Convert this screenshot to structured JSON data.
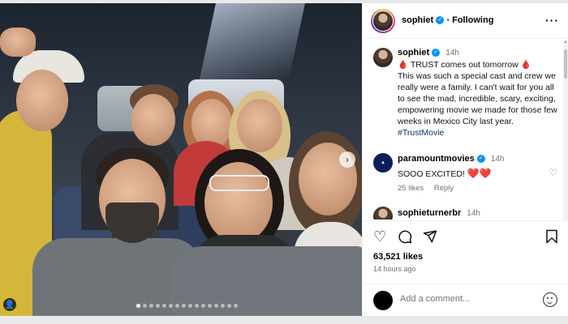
{
  "post": {
    "author": {
      "username": "sophiet",
      "follow_state": "Following",
      "separator": "•"
    },
    "comments": [
      {
        "username": "sophiet",
        "time": "14h",
        "caption_line1": "TRUST comes out tomorrow",
        "caption_body": "This was such a special cast and crew we really were a family. I can't wait for you all to see the mad, incredible, scary, exciting, empowering movie we made for those few weeks in Mexico City last year.",
        "hashtag": "#TrustMovie"
      },
      {
        "username": "paramountmovies",
        "time": "14h",
        "text": "SOOO EXCITED!",
        "likes_label": "25 likes",
        "reply_label": "Reply"
      },
      {
        "username": "sophieturnerbr",
        "time": "14h"
      }
    ],
    "likes_count": "63,521 likes",
    "posted_ago": "14 hours ago",
    "comment_placeholder": "Add a comment..."
  },
  "colors": {
    "verified": "#0095f6",
    "hashtag": "#00376b",
    "like_red": "#d0021b",
    "muted": "#737373"
  },
  "icons": {
    "verified": "verified-badge-icon",
    "more": "more-options-icon",
    "heart": "heart-icon",
    "comment": "comment-icon",
    "share": "share-icon",
    "save": "bookmark-icon",
    "emoji": "emoji-icon",
    "carousel_next": "chevron-right-icon",
    "user_tag": "user-tag-icon"
  },
  "carousel": {
    "total_slides": 16,
    "active_slide": 1
  }
}
